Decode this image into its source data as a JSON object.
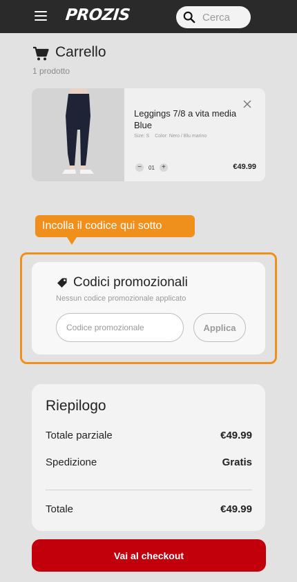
{
  "header": {
    "logo_text": "PROZIS",
    "search_placeholder": "Cerca",
    "menu_icon": "hamburger-icon",
    "search_icon": "search-icon"
  },
  "cart": {
    "title": "Carrello",
    "count_text": "1 prodotto",
    "icon": "shopping-cart-icon"
  },
  "product": {
    "name": "Leggings 7/8 a vita media Blue",
    "size": "Size: S",
    "color": "Color: Nero / Blu marino",
    "quantity": "01",
    "minus": "−",
    "plus": "+",
    "price": "€49.99",
    "remove_icon": "close-icon"
  },
  "tooltip": {
    "text": "Incolla il codice qui sotto"
  },
  "promo": {
    "title": "Codici promozionali",
    "subtitle": "Nessun codice promozionale applicato",
    "input_placeholder": "Codice promozionale",
    "apply_label": "Applica",
    "icon": "tag-icon"
  },
  "summary": {
    "title": "Riepilogo",
    "rows": [
      {
        "label": "Totale parziale",
        "value": "€49.99"
      },
      {
        "label": "Spedizione",
        "value": "Gratis"
      }
    ],
    "total_label": "Totale",
    "total_value": "€49.99"
  },
  "checkout": {
    "label": "Vai al checkout"
  },
  "colors": {
    "header_bg": "#2a2a2a",
    "accent_orange": "#f0901c",
    "checkout_red": "#c1000c"
  }
}
